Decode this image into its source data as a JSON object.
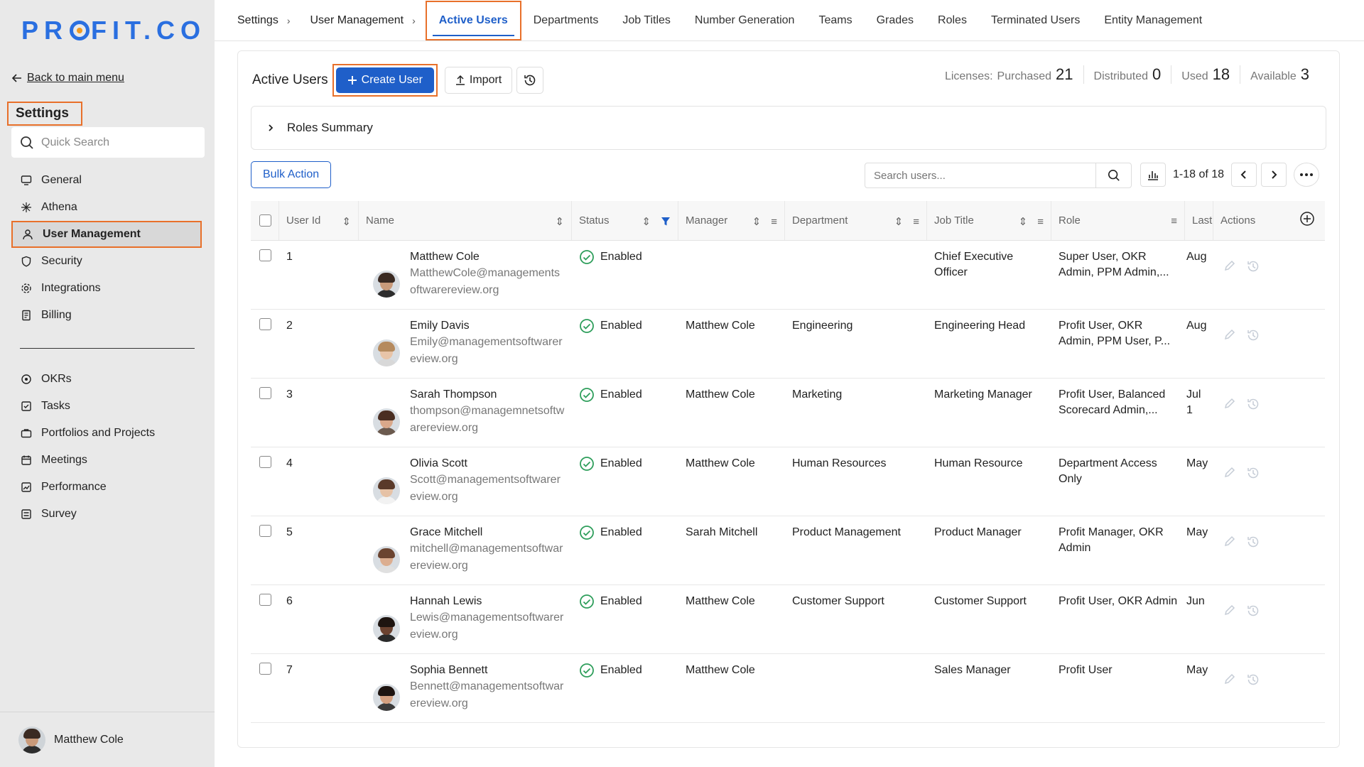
{
  "logo": {
    "left": "PR",
    "right": "FIT.CO"
  },
  "sidebar": {
    "back_label": "Back to main menu",
    "section_title": "Settings",
    "search_placeholder": "Quick Search",
    "items_top": [
      {
        "label": "General",
        "icon": "monitor-icon"
      },
      {
        "label": "Athena",
        "icon": "sparkle-icon"
      },
      {
        "label": "User Management",
        "icon": "user-icon",
        "active": true
      },
      {
        "label": "Security",
        "icon": "shield-icon"
      },
      {
        "label": "Integrations",
        "icon": "gear-icon"
      },
      {
        "label": "Billing",
        "icon": "receipt-icon"
      }
    ],
    "items_bottom": [
      {
        "label": "OKRs",
        "icon": "target-icon"
      },
      {
        "label": "Tasks",
        "icon": "checkbox-icon"
      },
      {
        "label": "Portfolios and Projects",
        "icon": "briefcase-icon"
      },
      {
        "label": "Meetings",
        "icon": "calendar-icon"
      },
      {
        "label": "Performance",
        "icon": "chart-icon"
      },
      {
        "label": "Survey",
        "icon": "survey-icon"
      }
    ],
    "footer_user": "Matthew Cole"
  },
  "breadcrumb": [
    "Settings",
    "User Management"
  ],
  "tabs": [
    "Active Users",
    "Departments",
    "Job Titles",
    "Number Generation",
    "Teams",
    "Grades",
    "Roles",
    "Terminated Users",
    "Entity Management"
  ],
  "active_tab": "Active Users",
  "page": {
    "title": "Active Users",
    "create_label": "Create User",
    "import_label": "Import",
    "licenses_label": "Licenses:",
    "purchased_label": "Purchased",
    "purchased": "21",
    "distributed_label": "Distributed",
    "distributed": "0",
    "used_label": "Used",
    "used": "18",
    "available_label": "Available",
    "available": "3",
    "roles_summary": "Roles Summary",
    "bulk_action": "Bulk Action",
    "search_placeholder": "Search users...",
    "page_range": "1-18 of 18"
  },
  "columns": {
    "user_id": "User Id",
    "name": "Name",
    "status": "Status",
    "manager": "Manager",
    "department": "Department",
    "job_title": "Job Title",
    "role": "Role",
    "last": "Last",
    "actions": "Actions"
  },
  "rows": [
    {
      "id": "1",
      "name": "Matthew Cole",
      "email": "MatthewCole@managementsoftwarereview.org",
      "status": "Enabled",
      "manager": "",
      "department": "",
      "job_title": "Chief Executive Officer",
      "role": "Super User, OKR Admin, PPM Admin,...",
      "last": "Aug",
      "skin": "#c99a7a",
      "hair": "#3a2a22",
      "shirt": "#2d2d2d"
    },
    {
      "id": "2",
      "name": "Emily Davis",
      "email": "Emily@managementsoftwarereview.org",
      "status": "Enabled",
      "manager": "Matthew Cole",
      "department": "Engineering",
      "job_title": "Engineering Head",
      "role": "Profit User, OKR Admin, PPM User, P...",
      "last": "Aug",
      "skin": "#e8c4a8",
      "hair": "#b58a5e",
      "shirt": "#d8d8d8"
    },
    {
      "id": "3",
      "name": "Sarah Thompson",
      "email": "thompson@managemnetsoftwarereview.org",
      "status": "Enabled",
      "manager": "Matthew Cole",
      "department": "Marketing",
      "job_title": "Marketing Manager",
      "role": "Profit User, Balanced Scorecard Admin,...",
      "last": "Jul 1",
      "skin": "#d9a88a",
      "hair": "#4a2e22",
      "shirt": "#6b5a4e"
    },
    {
      "id": "4",
      "name": "Olivia Scott",
      "email": "Scott@managementsoftwarereview.org",
      "status": "Enabled",
      "manager": "Matthew Cole",
      "department": "Human Resources",
      "job_title": "Human Resource",
      "role": "Department Access Only",
      "last": "May",
      "skin": "#e6c2a6",
      "hair": "#5a3a2a",
      "shirt": "#f2f2f2"
    },
    {
      "id": "5",
      "name": "Grace Mitchell",
      "email": "mitchell@managementsoftwarereview.org",
      "status": "Enabled",
      "manager": "Sarah Mitchell",
      "department": "Product Management",
      "job_title": "Product Manager",
      "role": "Profit Manager, OKR Admin",
      "last": "May",
      "skin": "#dcae90",
      "hair": "#6b4430",
      "shirt": "#e0e0e0"
    },
    {
      "id": "6",
      "name": "Hannah Lewis",
      "email": "Lewis@managementsoftwarereview.org",
      "status": "Enabled",
      "manager": "Matthew Cole",
      "department": "Customer Support",
      "job_title": "Customer Support",
      "role": "Profit User, OKR Admin",
      "last": "Jun",
      "skin": "#6b4230",
      "hair": "#1e1410",
      "shirt": "#2a2a2a"
    },
    {
      "id": "7",
      "name": "Sophia Bennett",
      "email": "Bennett@managementsoftwarereview.org",
      "status": "Enabled",
      "manager": "Matthew Cole",
      "department": "",
      "job_title": "Sales Manager",
      "role": "Profit User",
      "last": "May",
      "skin": "#d4a080",
      "hair": "#1e1410",
      "shirt": "#3b3b3b"
    }
  ],
  "colors": {
    "accent": "#1f5fc9",
    "highlight": "#e8702a",
    "enabled": "#2e9e5b"
  }
}
